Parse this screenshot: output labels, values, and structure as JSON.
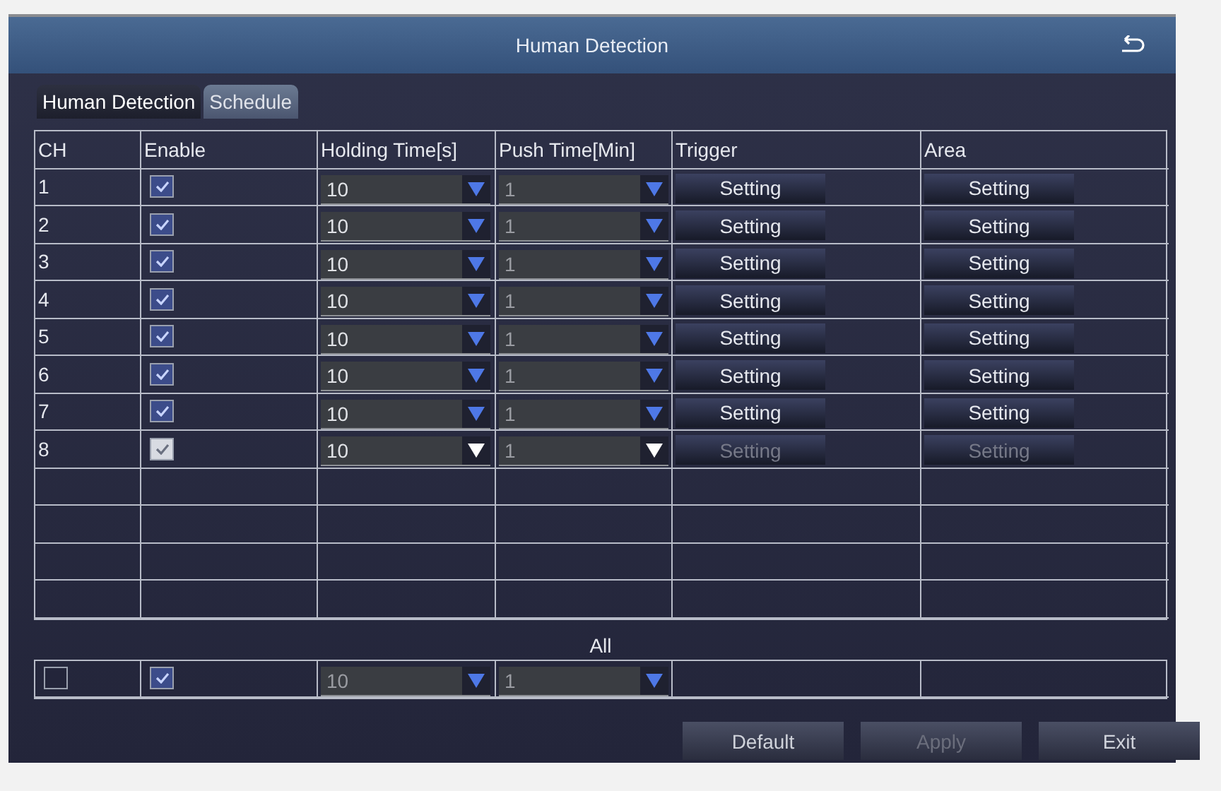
{
  "window": {
    "title": "Human Detection"
  },
  "tabs": [
    {
      "label": "Human Detection",
      "selected": true
    },
    {
      "label": "Schedule",
      "selected": false
    }
  ],
  "table": {
    "columns": [
      "CH",
      "Enable",
      "Holding Time[s]",
      "Push Time[Min]",
      "Trigger",
      "Area"
    ],
    "rows": [
      {
        "ch": "1",
        "enabled": true,
        "holding_time": "10",
        "push_time": "1",
        "trigger": "Setting",
        "area": "Setting",
        "selected": false
      },
      {
        "ch": "2",
        "enabled": true,
        "holding_time": "10",
        "push_time": "1",
        "trigger": "Setting",
        "area": "Setting",
        "selected": false
      },
      {
        "ch": "3",
        "enabled": true,
        "holding_time": "10",
        "push_time": "1",
        "trigger": "Setting",
        "area": "Setting",
        "selected": false
      },
      {
        "ch": "4",
        "enabled": true,
        "holding_time": "10",
        "push_time": "1",
        "trigger": "Setting",
        "area": "Setting",
        "selected": false
      },
      {
        "ch": "5",
        "enabled": true,
        "holding_time": "10",
        "push_time": "1",
        "trigger": "Setting",
        "area": "Setting",
        "selected": false
      },
      {
        "ch": "6",
        "enabled": true,
        "holding_time": "10",
        "push_time": "1",
        "trigger": "Setting",
        "area": "Setting",
        "selected": false
      },
      {
        "ch": "7",
        "enabled": true,
        "holding_time": "10",
        "push_time": "1",
        "trigger": "Setting",
        "area": "Setting",
        "selected": false
      },
      {
        "ch": "8",
        "enabled": true,
        "holding_time": "10",
        "push_time": "1",
        "trigger": "Setting",
        "area": "Setting",
        "selected": true
      }
    ]
  },
  "all": {
    "label": "All",
    "checked": false,
    "enabled": true,
    "holding_time": "10",
    "push_time": "1"
  },
  "buttons": [
    {
      "label": "Default",
      "disabled": false
    },
    {
      "label": "Apply",
      "disabled": true
    },
    {
      "label": "Exit",
      "disabled": false
    }
  ]
}
